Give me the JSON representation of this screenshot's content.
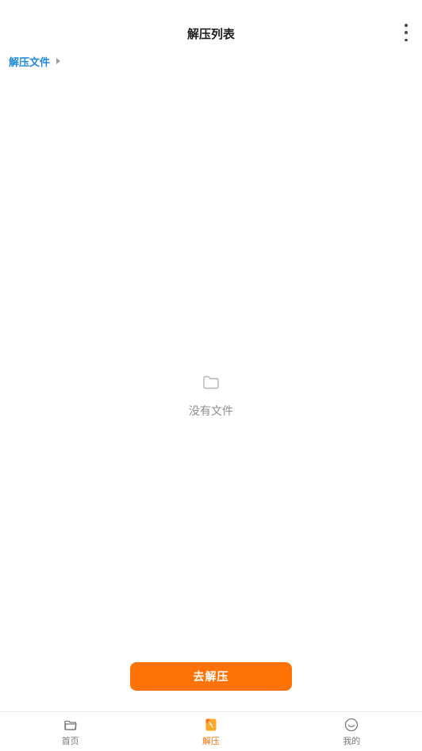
{
  "header": {
    "title": "解压列表",
    "more_icon": "more-vertical-icon"
  },
  "breadcrumb": {
    "items": [
      {
        "label": "解压文件"
      }
    ],
    "separator_icon": "chevron-right-icon"
  },
  "empty_state": {
    "icon": "folder-icon",
    "text": "没有文件"
  },
  "action": {
    "label": "去解压",
    "color": "#ff7306"
  },
  "tabbar": {
    "items": [
      {
        "label": "首页",
        "icon": "folder-open-icon",
        "active": false
      },
      {
        "label": "解压",
        "icon": "archive-file-icon",
        "active": true
      },
      {
        "label": "我的",
        "icon": "smiley-icon",
        "active": false
      }
    ],
    "active_color": "#ff7306",
    "inactive_color": "#7a7a7a"
  },
  "colors": {
    "accent": "#ff7306",
    "link": "#1e88e5"
  }
}
